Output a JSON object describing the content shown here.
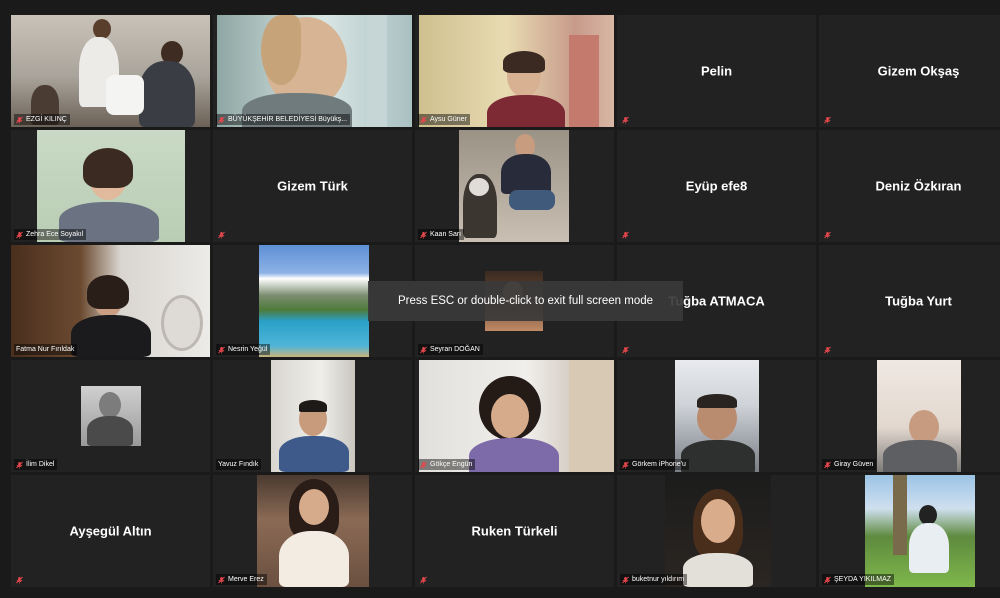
{
  "fullscreen_hint": "Press ESC or double-click to exit full screen mode",
  "colors": {
    "active_speaker_border": "#d9e05a",
    "muted_icon": "#e5484d",
    "tile_bg": "#222222"
  },
  "icons": {
    "muted": "mic-muted-icon"
  },
  "participants": [
    {
      "name": "EZGİ KILINÇ",
      "video": true,
      "muted": true,
      "active": true
    },
    {
      "name": "BÜYÜKŞEHİR BELEDİYESİ Büyükş...",
      "video": true,
      "muted": true
    },
    {
      "name": "Aysu Güner",
      "video": true,
      "muted": true
    },
    {
      "name": "Pelin",
      "video": false,
      "muted": true
    },
    {
      "name": "Gizem Okşaş",
      "video": false,
      "muted": true
    },
    {
      "name": "Zehra Ece Soyakıl",
      "video": true,
      "muted": true
    },
    {
      "name": "Gizem Türk",
      "video": false,
      "muted": true
    },
    {
      "name": "Kaan Sarı",
      "video": true,
      "muted": true
    },
    {
      "name": "Eyüp efe8",
      "video": false,
      "muted": true
    },
    {
      "name": "Deniz Özkıran",
      "video": false,
      "muted": true
    },
    {
      "name": "Fatma Nur Fırıldak",
      "video": true,
      "muted": false
    },
    {
      "name": "Nesrin Yeğül",
      "video": true,
      "muted": true
    },
    {
      "name": "Seyran DOĞAN",
      "video": true,
      "muted": true
    },
    {
      "name": "Tuğba ATMACA",
      "video": false,
      "muted": true
    },
    {
      "name": "Tuğba Yurt",
      "video": false,
      "muted": true
    },
    {
      "name": "İlim Dikel",
      "video": true,
      "muted": true
    },
    {
      "name": "Yavuz Fındık",
      "video": true,
      "muted": false
    },
    {
      "name": "Gökçe Engün",
      "video": true,
      "muted": true
    },
    {
      "name": "Görkem iPhone'u",
      "video": true,
      "muted": true
    },
    {
      "name": "Giray Güven",
      "video": true,
      "muted": true
    },
    {
      "name": "Ayşegül Altın",
      "video": false,
      "muted": true
    },
    {
      "name": "Merve Erez",
      "video": true,
      "muted": true
    },
    {
      "name": "Ruken Türkeli",
      "video": false,
      "muted": true
    },
    {
      "name": "buketnur yıldırım",
      "video": true,
      "muted": true
    },
    {
      "name": "ŞEYDA YIKILMAZ",
      "video": true,
      "muted": true
    }
  ]
}
